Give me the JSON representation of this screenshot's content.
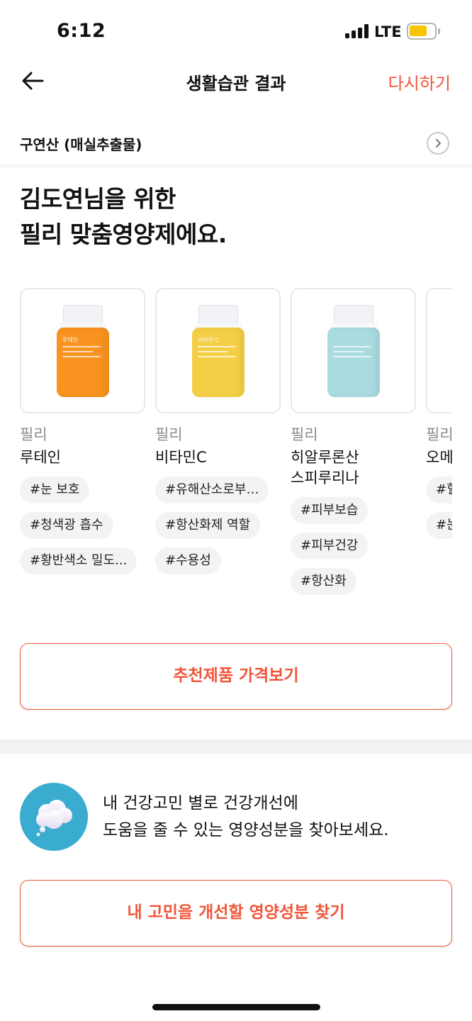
{
  "status_bar": {
    "time": "6:12",
    "network": "LTE"
  },
  "nav": {
    "title": "생활습관 결과",
    "retry_label": "다시하기"
  },
  "ingredient_row": {
    "label": "구연산 (매실추출물)"
  },
  "headline": {
    "line1": "김도연님을 위한",
    "line2": "필리 맞춤영양제에요."
  },
  "products": [
    {
      "brand": "필리",
      "name_line1": "루테인",
      "name_line2": "",
      "bottle_name": "루테인",
      "color": "#f7931e",
      "tags": [
        "#눈 보호",
        "#청색광 흡수",
        "#황반색소 밀도..."
      ]
    },
    {
      "brand": "필리",
      "name_line1": "비타민C",
      "name_line2": "",
      "bottle_name": "비타민 C",
      "color": "#f4cf45",
      "tags": [
        "#유해산소로부…",
        "#항산화제 역할",
        "#수용성"
      ]
    },
    {
      "brand": "필리",
      "name_line1": "히알루론산",
      "name_line2": "스피루리나",
      "bottle_name": "",
      "color": "#a9dbe0",
      "tags": [
        "#피부보습",
        "#피부건강",
        "#항산화"
      ]
    },
    {
      "brand": "필리",
      "name_line1": "오메",
      "name_line2": "",
      "bottle_name": "",
      "color": "#f3c27a",
      "tags": [
        "#혈",
        "#눈"
      ]
    }
  ],
  "price_button": {
    "label": "추천제품 가격보기"
  },
  "concern": {
    "line1": "내 건강고민 별로 건강개선에",
    "line2": "도움을 줄 수 있는 영양성분을 찾아보세요."
  },
  "find_button": {
    "label": "내 고민을 개선할 영양성분 찾기"
  },
  "colors": {
    "accent": "#f0553a",
    "concern_icon_bg": "#3aaccf"
  }
}
